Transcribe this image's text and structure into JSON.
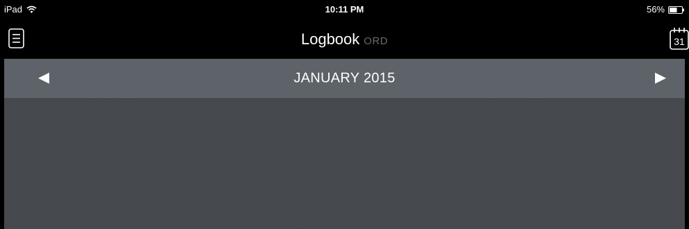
{
  "status_bar": {
    "device": "iPad",
    "time": "10:11 PM",
    "battery": "56%"
  },
  "nav_bar": {
    "title": "Logbook",
    "subtitle": "ORD",
    "calendar_day": "31"
  },
  "month_bar": {
    "label": "JANUARY 2015"
  },
  "colors": {
    "background": "#000000",
    "month_bar": "#5e636a",
    "content": "#45484d",
    "subtitle": "#6b6b6b"
  }
}
